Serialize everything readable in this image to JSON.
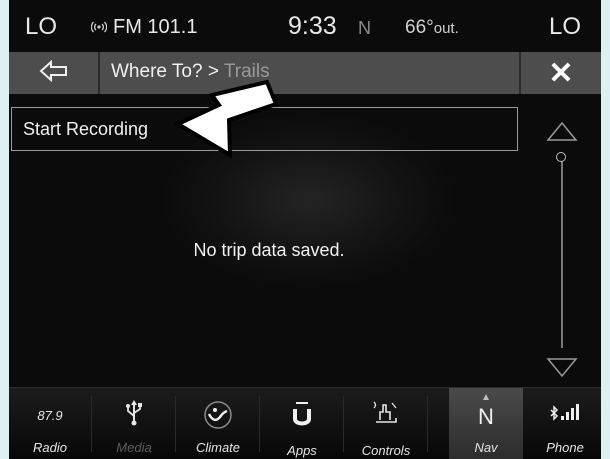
{
  "status_bar": {
    "left_zone": "LO",
    "radio_icon": "radio-signal-icon",
    "radio_label": "FM 101.1",
    "time": "9:33",
    "compass": "N",
    "temperature": "66°",
    "temperature_unit": "out.",
    "right_zone": "LO"
  },
  "title_bar": {
    "back_icon": "back-arrow-icon",
    "breadcrumb_parent": "Where To?",
    "breadcrumb_separator": ">",
    "breadcrumb_current": "Trails",
    "close_label": "✕"
  },
  "content": {
    "start_recording_label": "Start Recording",
    "empty_message": "No trip data saved.",
    "annotation_icon": "pointer-arrow-icon"
  },
  "scroll": {
    "up_icon": "scroll-up-icon",
    "down_icon": "scroll-down-icon"
  },
  "nav_bar": {
    "radio_freq": "87.9",
    "items": [
      {
        "label": "Radio",
        "icon": "radio-frequency"
      },
      {
        "label": "Media",
        "icon": "usb-icon"
      },
      {
        "label": "Climate",
        "icon": "climate-icon"
      },
      {
        "label": "Apps",
        "icon": "apps-icon"
      },
      {
        "label": "Controls",
        "icon": "controls-icon"
      },
      {
        "label": "Nav",
        "icon": "compass-n-icon",
        "icon_text": "N"
      },
      {
        "label": "Phone",
        "icon": "phone-bluetooth-icon"
      }
    ]
  },
  "colors": {
    "background": "#0b0b0b",
    "title_bar": "#4d4d4d",
    "text": "#f0f0f0",
    "dim_text": "#9a9a9a",
    "page_border": "#dff0f3"
  }
}
